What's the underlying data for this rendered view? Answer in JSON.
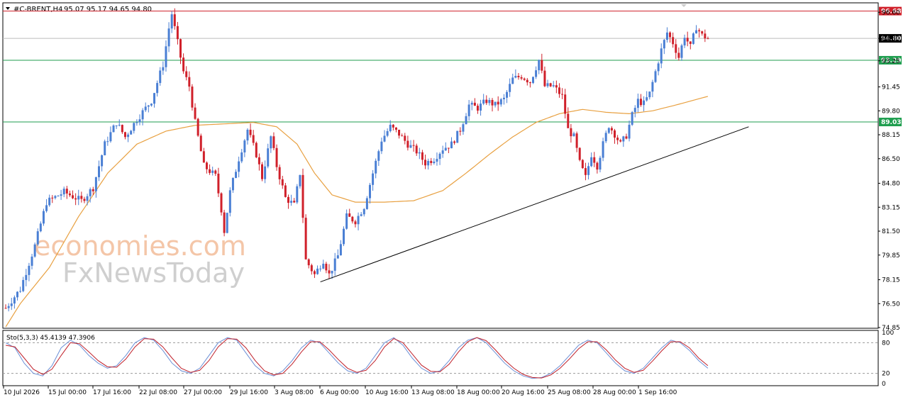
{
  "header": {
    "symbol": "#C-BRENT,H4",
    "ohlc": "95.07 95.17 94.65 94.80"
  },
  "watermark": {
    "line1": "economies.com",
    "line2": "FxNewsToday"
  },
  "colors": {
    "bull": "#4a7fd4",
    "bear": "#d0202a",
    "ma": "#e8a040",
    "resistance": "#d0202a",
    "support": "#1f9e4f",
    "current": "#000000",
    "stoch_main": "#6b8fd6",
    "stoch_signal": "#c0202a"
  },
  "price_levels": [
    {
      "name": "resistance",
      "value": 96.68,
      "label": "96.68"
    },
    {
      "name": "current",
      "value": 94.8,
      "label": "94.80"
    },
    {
      "name": "support-1",
      "value": 93.29,
      "label": "93.29"
    },
    {
      "name": "support-2",
      "value": 89.03,
      "label": "89.03"
    }
  ],
  "stochastic": {
    "label": "Sto(5,3,3) 45.4139 47.3906",
    "ticks": [
      "100",
      "80",
      "20",
      "0"
    ]
  },
  "chart_data": {
    "type": "candlestick",
    "title": "#C-BRENT,H4",
    "ylim": [
      74.85,
      97.2
    ],
    "y_ticks": [
      "96.60",
      "94.80",
      "93.25",
      "91.45",
      "89.80",
      "88.15",
      "86.50",
      "84.80",
      "83.15",
      "81.50",
      "79.85",
      "78.15",
      "76.50",
      "74.85"
    ],
    "x_ticks": [
      "10 Jul 2026",
      "15 Jul 00:00",
      "17 Jul 16:00",
      "22 Jul 08:00",
      "27 Jul 00:00",
      "29 Jul 16:00",
      "3 Aug 08:00",
      "6 Aug 00:00",
      "10 Aug 16:00",
      "13 Aug 08:00",
      "18 Aug 00:00",
      "20 Aug 16:00",
      "25 Aug 08:00",
      "28 Aug 00:00",
      "1 Sep 16:00"
    ],
    "close_path": [
      [
        0,
        76.2
      ],
      [
        5,
        77.5
      ],
      [
        10,
        80.5
      ],
      [
        14,
        83.5
      ],
      [
        20,
        84.2
      ],
      [
        26,
        83.6
      ],
      [
        30,
        84.5
      ],
      [
        34,
        87.5
      ],
      [
        38,
        89.0
      ],
      [
        41,
        88.0
      ],
      [
        45,
        89.2
      ],
      [
        50,
        90.5
      ],
      [
        54,
        93.0
      ],
      [
        56,
        95.5
      ],
      [
        57,
        96.5
      ],
      [
        59,
        94.5
      ],
      [
        61,
        92.5
      ],
      [
        63,
        91.5
      ],
      [
        65,
        89.0
      ],
      [
        68,
        86.0
      ],
      [
        72,
        85.3
      ],
      [
        74,
        83.0
      ],
      [
        75,
        81.5
      ],
      [
        77,
        84.2
      ],
      [
        80,
        86.5
      ],
      [
        83,
        88.5
      ],
      [
        86,
        86.8
      ],
      [
        88,
        85.2
      ],
      [
        91,
        88.0
      ],
      [
        93,
        86.0
      ],
      [
        96,
        83.8
      ],
      [
        99,
        83.3
      ],
      [
        101,
        85.5
      ],
      [
        103,
        79.5
      ],
      [
        106,
        78.5
      ],
      [
        109,
        79.5
      ],
      [
        111,
        78.5
      ],
      [
        114,
        79.8
      ],
      [
        117,
        82.5
      ],
      [
        120,
        82.2
      ],
      [
        123,
        83.2
      ],
      [
        126,
        85.5
      ],
      [
        129,
        87.8
      ],
      [
        132,
        88.7
      ],
      [
        135,
        88.2
      ],
      [
        138,
        87.5
      ],
      [
        141,
        87.0
      ],
      [
        144,
        86.2
      ],
      [
        147,
        86.5
      ],
      [
        150,
        87.2
      ],
      [
        153,
        87.5
      ],
      [
        156,
        88.5
      ],
      [
        159,
        90.2
      ],
      [
        162,
        90.0
      ],
      [
        165,
        90.5
      ],
      [
        168,
        90.2
      ],
      [
        171,
        90.6
      ],
      [
        174,
        92.0
      ],
      [
        177,
        92.2
      ],
      [
        180,
        91.8
      ],
      [
        183,
        93.3
      ],
      [
        185,
        91.5
      ],
      [
        188,
        91.5
      ],
      [
        191,
        90.8
      ],
      [
        193,
        88.5
      ],
      [
        195,
        88.0
      ],
      [
        197,
        86.2
      ],
      [
        199,
        85.2
      ],
      [
        201,
        86.8
      ],
      [
        203,
        86.0
      ],
      [
        205,
        87.5
      ],
      [
        207,
        88.8
      ],
      [
        209,
        88.2
      ],
      [
        211,
        87.5
      ],
      [
        213,
        88.1
      ],
      [
        215,
        89.5
      ],
      [
        217,
        90.5
      ],
      [
        219,
        90.3
      ],
      [
        221,
        91.0
      ],
      [
        223,
        92.5
      ],
      [
        225,
        94.0
      ],
      [
        227,
        95.2
      ],
      [
        229,
        94.5
      ],
      [
        231,
        93.5
      ],
      [
        233,
        95.0
      ],
      [
        235,
        94.2
      ],
      [
        237,
        95.6
      ],
      [
        239,
        95.0
      ],
      [
        241,
        94.8
      ]
    ],
    "ma_path": [
      [
        0,
        74.9
      ],
      [
        5,
        76.5
      ],
      [
        15,
        79.0
      ],
      [
        25,
        82.5
      ],
      [
        35,
        85.5
      ],
      [
        45,
        87.5
      ],
      [
        55,
        88.4
      ],
      [
        65,
        88.8
      ],
      [
        75,
        88.9
      ],
      [
        85,
        89.0
      ],
      [
        93,
        88.7
      ],
      [
        100,
        87.5
      ],
      [
        106,
        85.5
      ],
      [
        112,
        84.0
      ],
      [
        120,
        83.5
      ],
      [
        130,
        83.5
      ],
      [
        140,
        83.6
      ],
      [
        150,
        84.3
      ],
      [
        158,
        85.5
      ],
      [
        166,
        86.8
      ],
      [
        174,
        88.0
      ],
      [
        182,
        89.0
      ],
      [
        190,
        89.6
      ],
      [
        198,
        89.9
      ],
      [
        206,
        89.7
      ],
      [
        214,
        89.6
      ],
      [
        222,
        89.8
      ],
      [
        230,
        90.2
      ],
      [
        241,
        90.8
      ]
    ],
    "trendline": {
      "start": [
        108,
        78.0
      ],
      "end": [
        255,
        88.7
      ]
    },
    "stoch_main": [
      80,
      70,
      40,
      20,
      15,
      35,
      70,
      85,
      75,
      55,
      40,
      30,
      35,
      55,
      80,
      90,
      85,
      65,
      40,
      25,
      20,
      30,
      55,
      80,
      90,
      85,
      60,
      35,
      20,
      15,
      25,
      45,
      70,
      85,
      80,
      60,
      40,
      25,
      20,
      30,
      55,
      80,
      90,
      75,
      50,
      30,
      20,
      25,
      45,
      70,
      85,
      90,
      80,
      60,
      40,
      25,
      15,
      10,
      12,
      20,
      35,
      55,
      75,
      85,
      80,
      60,
      40,
      25,
      20,
      30,
      50,
      70,
      85,
      80,
      65,
      45,
      30
    ],
    "stoch_signal": [
      75,
      72,
      50,
      28,
      18,
      28,
      55,
      80,
      78,
      62,
      45,
      33,
      32,
      48,
      72,
      88,
      87,
      72,
      50,
      30,
      22,
      26,
      45,
      72,
      88,
      87,
      70,
      45,
      25,
      17,
      20,
      38,
      62,
      82,
      82,
      66,
      47,
      30,
      22,
      26,
      45,
      72,
      88,
      80,
      58,
      36,
      24,
      23,
      38,
      62,
      82,
      90,
      84,
      66,
      46,
      30,
      18,
      12,
      11,
      17,
      30,
      48,
      68,
      82,
      82,
      66,
      46,
      30,
      22,
      26,
      44,
      64,
      82,
      82,
      70,
      50,
      35
    ]
  }
}
